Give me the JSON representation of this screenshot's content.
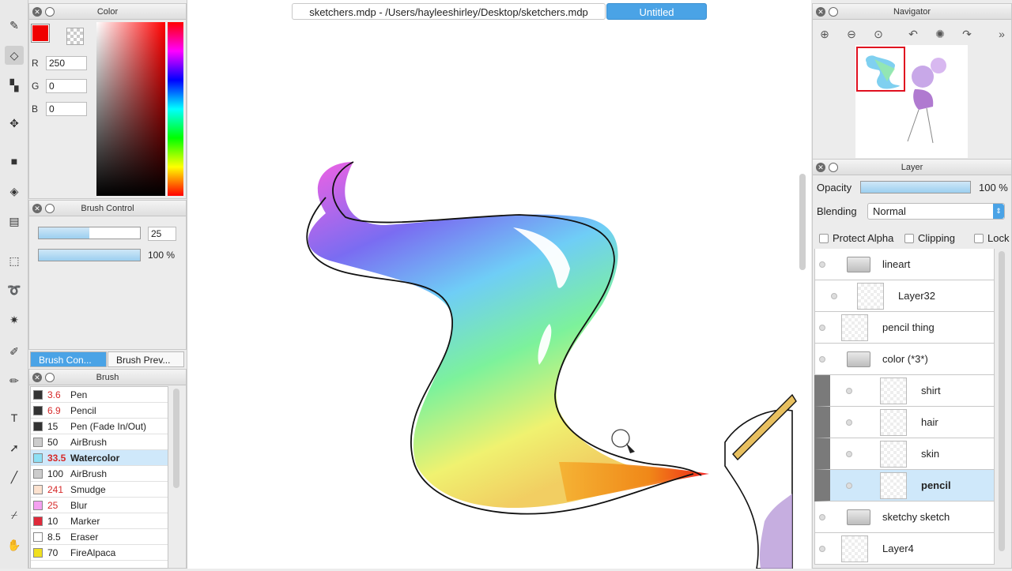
{
  "document_tabs": [
    {
      "label": "sketchers.mdp - /Users/hayleeshirley/Desktop/sketchers.mdp",
      "active": false
    },
    {
      "label": "Untitled",
      "active": true
    }
  ],
  "color_panel": {
    "title": "Color",
    "foreground": "#f00000",
    "r_label": "R",
    "r_value": "250",
    "g_label": "G",
    "g_value": "0",
    "b_label": "B",
    "b_value": "0"
  },
  "brush_control": {
    "title": "Brush Control",
    "size_value": "25",
    "size_fraction": 0.5,
    "opacity_value": "100 %",
    "opacity_fraction": 1.0
  },
  "tabs": {
    "brush_control": "Brush Con...",
    "brush_preview": "Brush Prev..."
  },
  "brush_panel": {
    "title": "Brush",
    "items": [
      {
        "size": "3.6",
        "name": "Pen",
        "color": "#333333",
        "size_red": true
      },
      {
        "size": "6.9",
        "name": "Pencil",
        "color": "#333333",
        "size_red": true
      },
      {
        "size": "15",
        "name": "Pen (Fade In/Out)",
        "color": "#333333",
        "size_red": false
      },
      {
        "size": "50",
        "name": "AirBrush",
        "color": "#cccccc",
        "size_red": false
      },
      {
        "size": "33.5",
        "name": "Watercolor",
        "color": "#8de0f5",
        "size_red": true,
        "selected": true
      },
      {
        "size": "100",
        "name": "AirBrush",
        "color": "#cccccc",
        "size_red": false
      },
      {
        "size": "241",
        "name": "Smudge",
        "color": "#fde2cf",
        "size_red": true
      },
      {
        "size": "25",
        "name": "Blur",
        "color": "#f4a0f0",
        "size_red": true
      },
      {
        "size": "10",
        "name": "Marker",
        "color": "#e02a3a",
        "size_red": false
      },
      {
        "size": "8.5",
        "name": "Eraser",
        "color": "#ffffff",
        "size_red": false
      },
      {
        "size": "70",
        "name": "FireAlpaca",
        "color": "#f0e020",
        "size_red": false
      }
    ]
  },
  "navigator": {
    "title": "Navigator"
  },
  "layer_panel": {
    "title": "Layer",
    "opacity_label": "Opacity",
    "opacity_value": "100 %",
    "opacity_fraction": 1.0,
    "blending_label": "Blending",
    "blending_value": "Normal",
    "protect_alpha": "Protect Alpha",
    "clipping": "Clipping",
    "lock": "Lock",
    "layers": [
      {
        "name": "lineart",
        "type": "folder",
        "indent": 0
      },
      {
        "name": "Layer32",
        "type": "layer",
        "indent": 1
      },
      {
        "name": "pencil thing",
        "type": "layer",
        "indent": 0
      },
      {
        "name": "color (*3*)",
        "type": "folder",
        "indent": 0
      },
      {
        "name": "shirt",
        "type": "layer",
        "indent": 2
      },
      {
        "name": "hair",
        "type": "layer",
        "indent": 2
      },
      {
        "name": "skin",
        "type": "layer",
        "indent": 2
      },
      {
        "name": "pencil",
        "type": "layer",
        "indent": 2,
        "selected": true
      },
      {
        "name": "sketchy sketch",
        "type": "folder",
        "indent": 0
      },
      {
        "name": "Layer4",
        "type": "layer",
        "indent": 0
      }
    ]
  }
}
